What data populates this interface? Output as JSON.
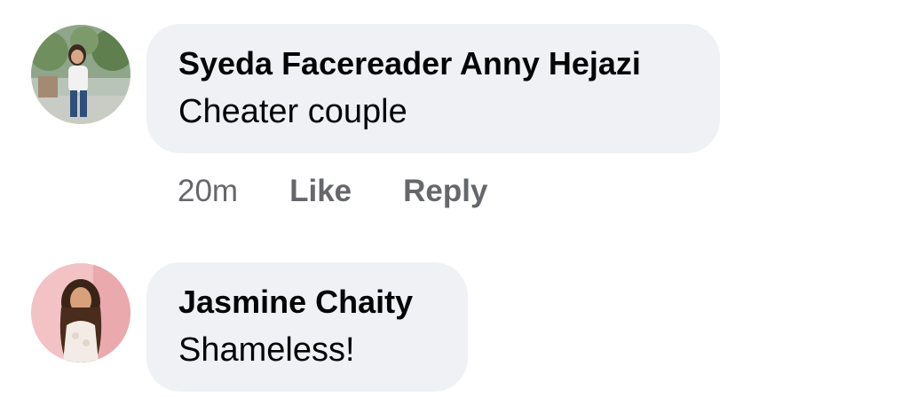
{
  "comments": [
    {
      "author": "Syeda Facereader Anny Hejazi",
      "text": "Cheater couple",
      "time": "20m",
      "like_label": "Like",
      "reply_label": "Reply"
    },
    {
      "author": "Jasmine Chaity",
      "text": "Shameless!"
    }
  ],
  "colors": {
    "bubble": "#eff1f5",
    "text": "#050505",
    "meta": "#65676b"
  }
}
